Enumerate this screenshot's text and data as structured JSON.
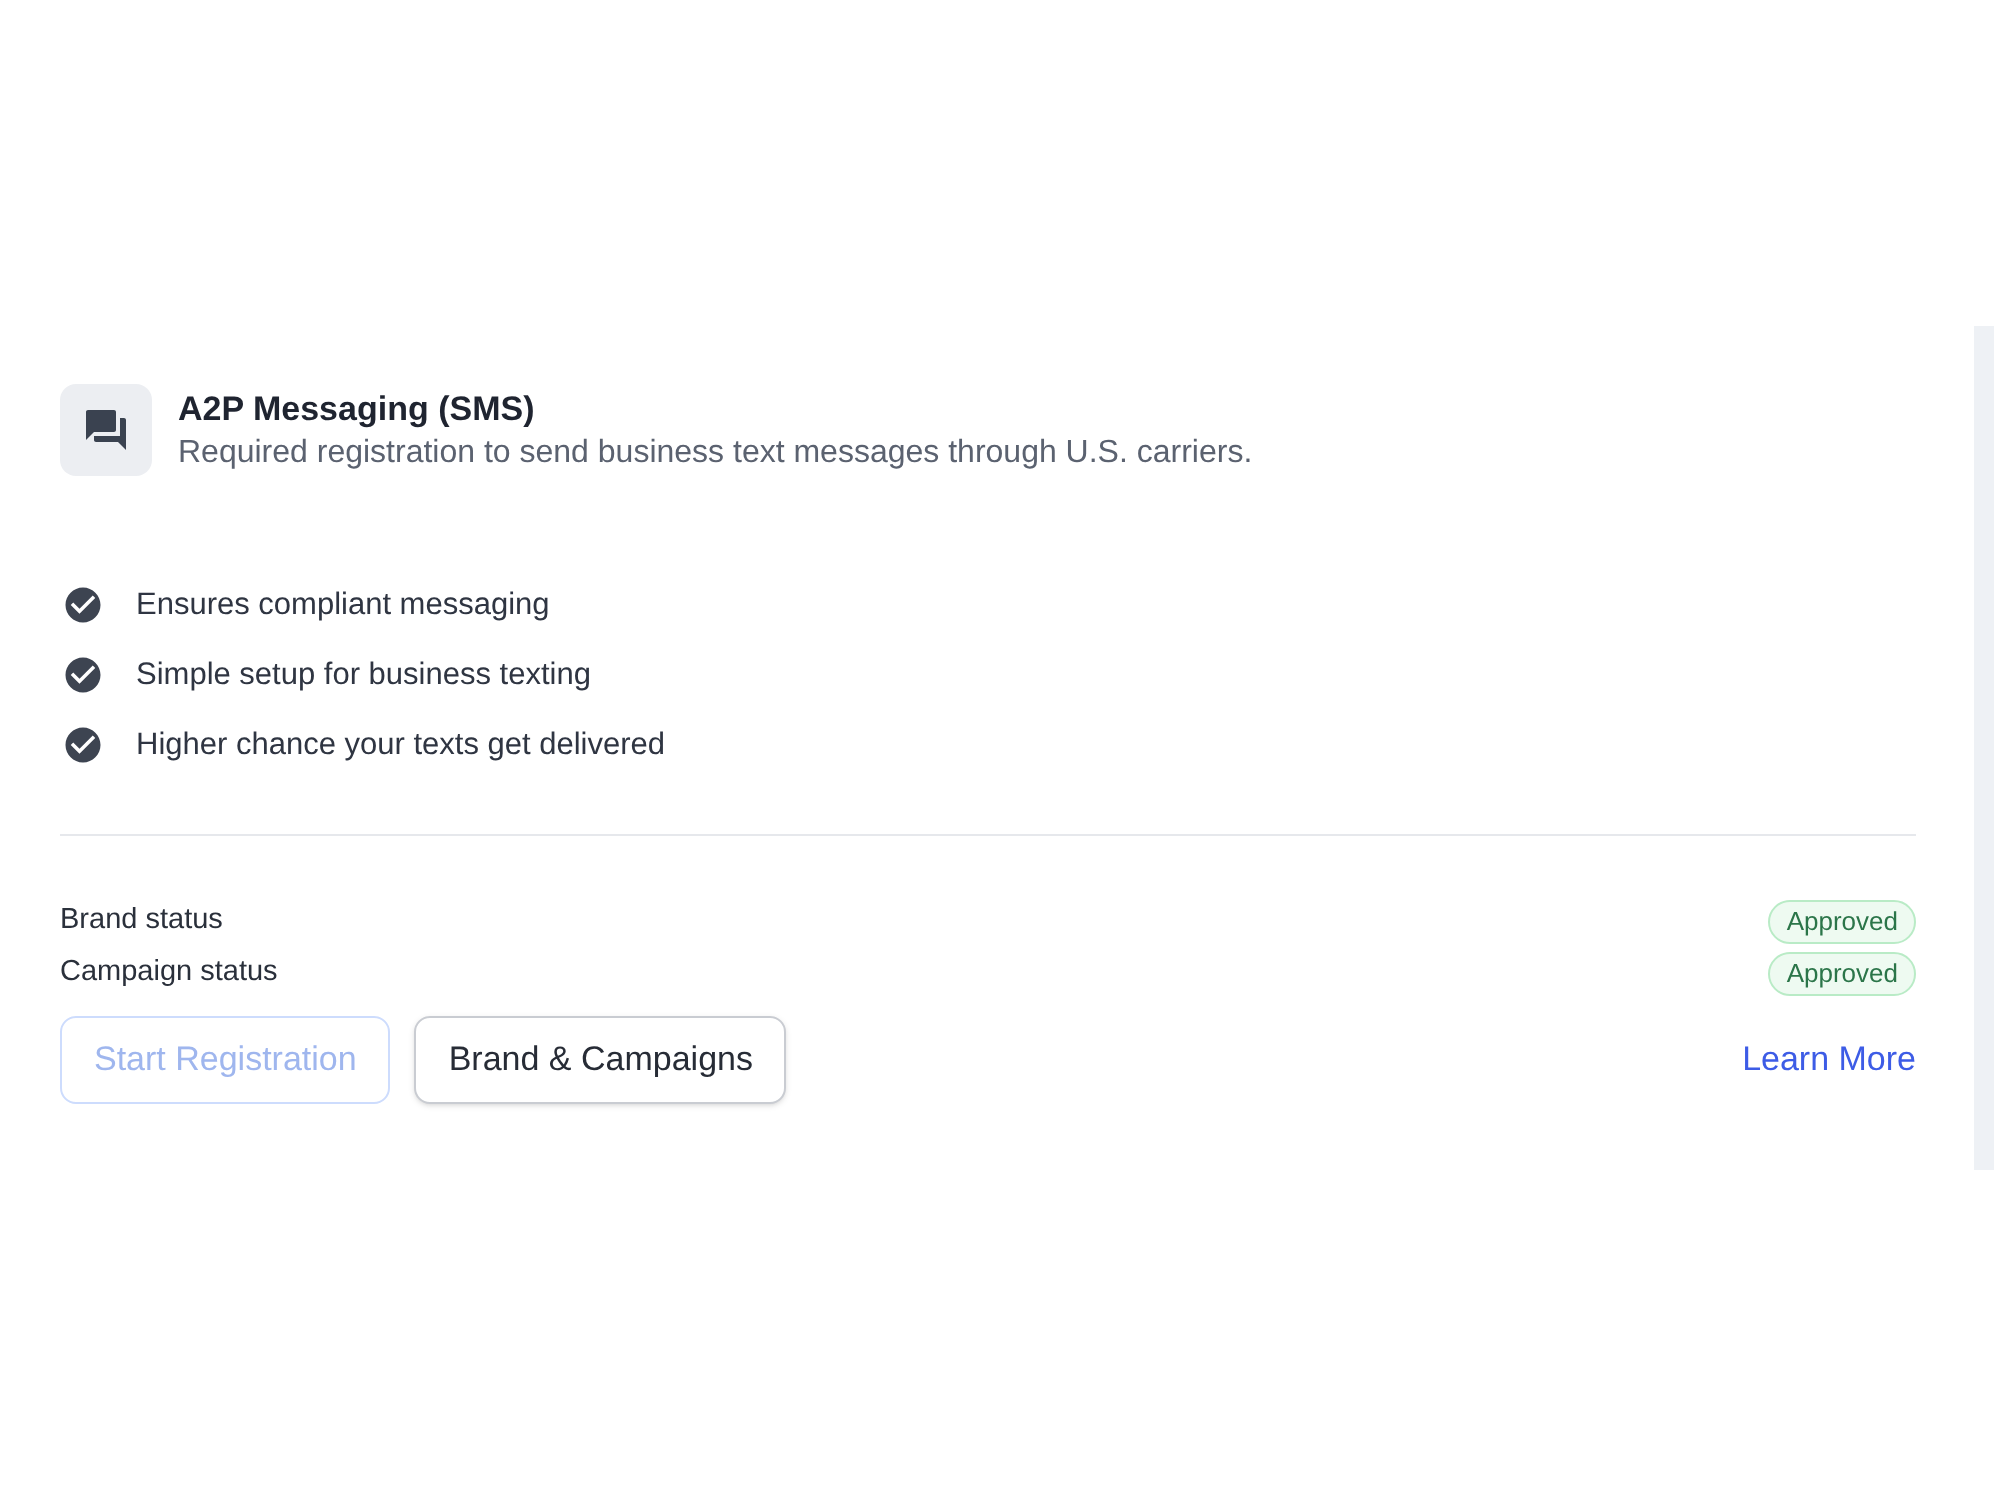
{
  "card": {
    "title": "A2P Messaging (SMS)",
    "description": "Required registration to send business text messages through U.S. carriers."
  },
  "features": [
    "Ensures compliant messaging",
    "Simple setup for business texting",
    "Higher chance your texts get delivered"
  ],
  "statuses": [
    {
      "label": "Brand status",
      "badge": "Approved"
    },
    {
      "label": "Campaign status",
      "badge": "Approved"
    }
  ],
  "actions": [
    {
      "label": "Start Registration",
      "disabled": true
    },
    {
      "label": "Brand & Campaigns",
      "disabled": false
    }
  ],
  "link": {
    "label": "Learn More"
  }
}
